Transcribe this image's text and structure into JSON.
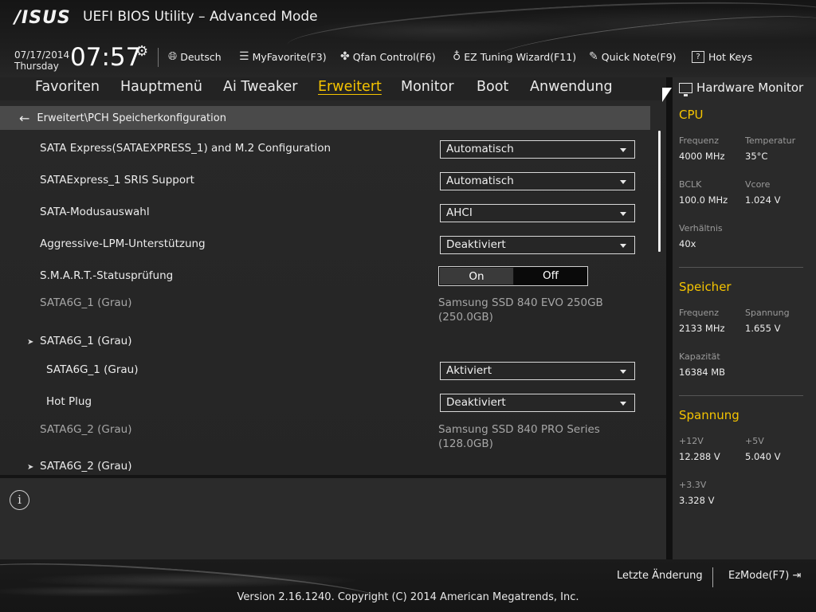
{
  "header": {
    "logo": "/ISUS",
    "title": "UEFI BIOS Utility – Advanced Mode",
    "date": "07/17/2014",
    "weekday": "Thursday",
    "time": "07:57",
    "toolbar": {
      "language": "Deutsch",
      "myfavorite": "MyFavorite(F3)",
      "qfan": "Qfan Control(F6)",
      "ez_tuning": "EZ Tuning Wizard(F11)",
      "quick_note": "Quick Note(F9)",
      "hot_keys": "Hot Keys",
      "hot_keys_key": "?"
    }
  },
  "tabs": {
    "favoriten": "Favoriten",
    "hauptmenu": "Hauptmenü",
    "ai_tweaker": "Ai Tweaker",
    "erweitert": "Erweitert",
    "monitor": "Monitor",
    "boot": "Boot",
    "anwendung": "Anwendung",
    "active": "Erweitert"
  },
  "breadcrumb": "Erweitert\\PCH Speicherkonfiguration",
  "settings": {
    "sataexpress_config": {
      "label": "SATA Express(SATAEXPRESS_1) and M.2 Configuration",
      "value": "Automatisch"
    },
    "sris_support": {
      "label": "SATAExpress_1 SRIS Support",
      "value": "Automatisch"
    },
    "sata_mode": {
      "label": "SATA-Modusauswahl",
      "value": "AHCI"
    },
    "aggressive_lpm": {
      "label": "Aggressive-LPM-Unterstützung",
      "value": "Deaktiviert"
    },
    "smart": {
      "label": "S.M.A.R.T.-Statusprüfung",
      "on": "On",
      "off": "Off",
      "selected": "On"
    },
    "sata6g1_info": {
      "label": "SATA6G_1 (Grau)",
      "line1": "Samsung SSD 840 EVO 250GB",
      "line2": "(250.0GB)"
    },
    "sata6g1_group": {
      "label": "SATA6G_1 (Grau)"
    },
    "sata6g1_port": {
      "label": "SATA6G_1 (Grau)",
      "value": "Aktiviert"
    },
    "hot_plug": {
      "label": "Hot Plug",
      "value": "Deaktiviert"
    },
    "sata6g2_info": {
      "label": "SATA6G_2 (Grau)",
      "line1": "Samsung SSD 840 PRO Series",
      "line2": "(128.0GB)"
    },
    "sata6g2_group": {
      "label": "SATA6G_2 (Grau)"
    }
  },
  "hardware_monitor": {
    "title": "Hardware Monitor",
    "cpu": {
      "section": "CPU",
      "freq_label": "Frequenz",
      "freq_value": "4000 MHz",
      "temp_label": "Temperatur",
      "temp_value": "35°C",
      "bclk_label": "BCLK",
      "bclk_value": "100.0 MHz",
      "vcore_label": "Vcore",
      "vcore_value": "1.024 V",
      "ratio_label": "Verhältnis",
      "ratio_value": "40x"
    },
    "memory": {
      "section": "Speicher",
      "freq_label": "Frequenz",
      "freq_value": "2133 MHz",
      "volt_label": "Spannung",
      "volt_value": "1.655 V",
      "cap_label": "Kapazität",
      "cap_value": "16384 MB"
    },
    "voltage": {
      "section": "Spannung",
      "v12_label": "+12V",
      "v12_value": "12.288 V",
      "v5_label": "+5V",
      "v5_value": "5.040 V",
      "v33_label": "+3.3V",
      "v33_value": "3.328 V"
    }
  },
  "footer": {
    "last_change": "Letzte Änderung",
    "ezmode": "EzMode(F7)",
    "copyright": "Version 2.16.1240. Copyright (C) 2014 American Megatrends, Inc."
  },
  "colors": {
    "accent": "#f5c400",
    "panel": "#282828",
    "breadcrumb_bg": "#4a4a4a"
  }
}
